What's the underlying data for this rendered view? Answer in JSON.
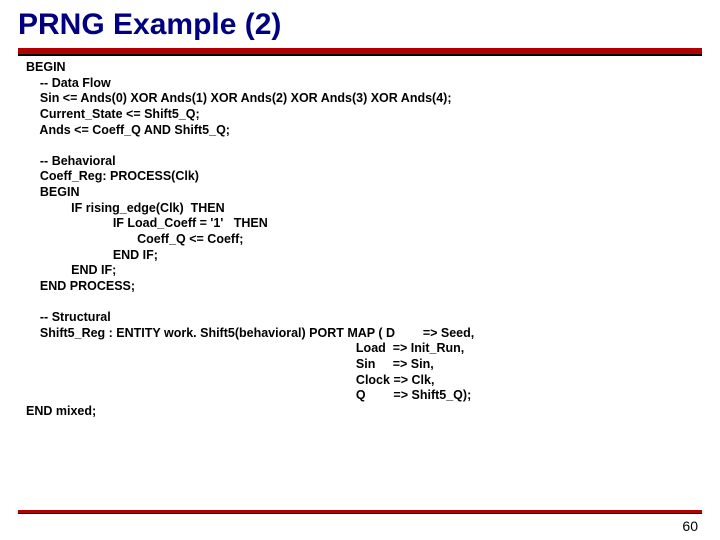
{
  "title": "PRNG Example (2)",
  "code": "BEGIN\n    -- Data Flow\n    Sin <= Ands(0) XOR Ands(1) XOR Ands(2) XOR Ands(3) XOR Ands(4);\n    Current_State <= Shift5_Q;\n    Ands <= Coeff_Q AND Shift5_Q;\n\n    -- Behavioral\n    Coeff_Reg: PROCESS(Clk)\n    BEGIN\n             IF rising_edge(Clk)  THEN\n                         IF Load_Coeff = '1'   THEN\n                                Coeff_Q <= Coeff;\n                         END IF;\n             END IF;\n    END PROCESS;\n\n    -- Structural\n    Shift5_Reg : ENTITY work. Shift5(behavioral) PORT MAP ( D        => Seed,\n                                                                                               Load  => Init_Run,\n                                                                                               Sin     => Sin,\n                                                                                               Clock => Clk,\n                                                                                               Q        => Shift5_Q);\nEND mixed;",
  "page_number": "60"
}
